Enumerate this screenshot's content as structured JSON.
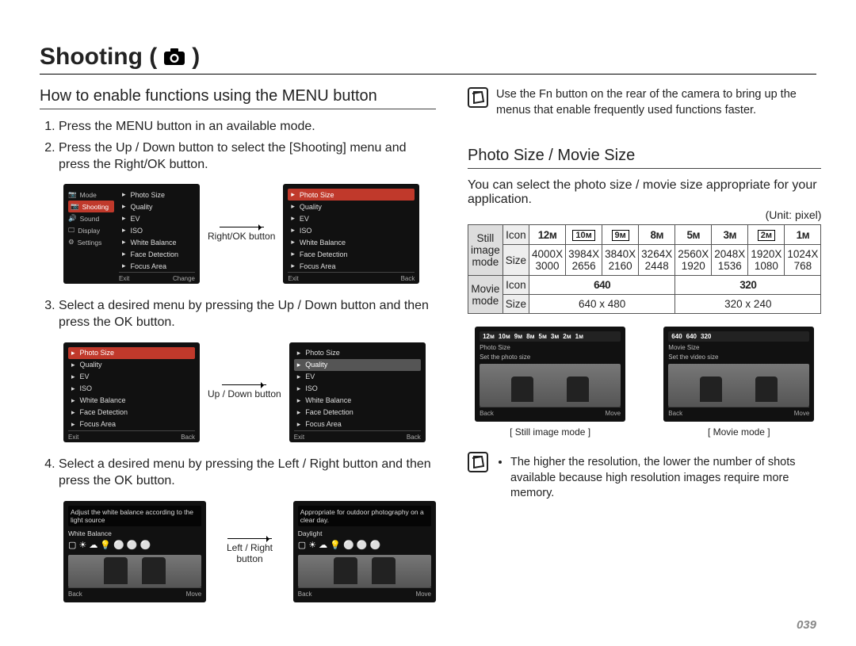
{
  "page_title": "Shooting (",
  "page_title_suffix": ")",
  "page_number": "039",
  "left": {
    "section_heading": "How to enable functions using the MENU button",
    "step1": "Press the MENU button in an available mode.",
    "step2": "Press the Up / Down button to select the [Shooting] menu and press the Right/OK button.",
    "step3": "Select a desired menu by pressing the Up / Down button and then press the OK button.",
    "step4": "Select a desired menu by pressing the Left / Right button and then press the OK button.",
    "arrow1": "Right/OK button",
    "arrow2": "Up / Down button",
    "arrow3": "Left / Right button",
    "menu1_left": [
      "Mode",
      "Shooting",
      "Sound",
      "Display",
      "Settings"
    ],
    "menu1_right": [
      "Photo Size",
      "Quality",
      "EV",
      "ISO",
      "White Balance",
      "Face Detection",
      "Focus Area"
    ],
    "footer_exit": "Exit",
    "footer_change": "Change",
    "footer_back": "Back",
    "footer_move": "Move",
    "wb_desc1": "Adjust the white balance according to the light source",
    "wb_label1": "White Balance",
    "wb_desc2": "Appropriate for outdoor photography on a clear day.",
    "wb_label2": "Daylight"
  },
  "right": {
    "tip1": "Use the Fn button on the rear of the camera to bring up the menus that enable frequently used functions faster.",
    "section_heading": "Photo Size / Movie Size",
    "intro": "You can select the photo size / movie size appropriate for your application.",
    "unit_label": "(Unit: pixel)",
    "tbl": {
      "still_label": "Still image mode",
      "movie_label": "Movie mode",
      "icon_label": "Icon",
      "size_label": "Size",
      "still_icons": [
        "12ᴍ",
        "10ᴍ",
        "9ᴍ",
        "8ᴍ",
        "5ᴍ",
        "3ᴍ",
        "2ᴍ",
        "1ᴍ"
      ],
      "still_sizes_top": [
        "4000X",
        "3984X",
        "3840X",
        "3264X",
        "2560X",
        "2048X",
        "1920X",
        "1024X"
      ],
      "still_sizes_bot": [
        "3000",
        "2656",
        "2160",
        "2448",
        "1920",
        "1536",
        "1080",
        "768"
      ],
      "movie_icons": [
        "640",
        "320"
      ],
      "movie_sizes": [
        "640 x 480",
        "320 x 240"
      ]
    },
    "preview1_caption": "[ Still image mode ]",
    "preview1_label1": "Photo Size",
    "preview1_label2": "Set the photo size",
    "preview2_caption": "[ Movie mode ]",
    "preview2_label1": "Movie Size",
    "preview2_label2": "Set the video size",
    "preview2_icons": [
      "640",
      "640",
      "320"
    ],
    "tip2": "The higher the resolution, the lower the number of shots available because high resolution images require more memory."
  }
}
